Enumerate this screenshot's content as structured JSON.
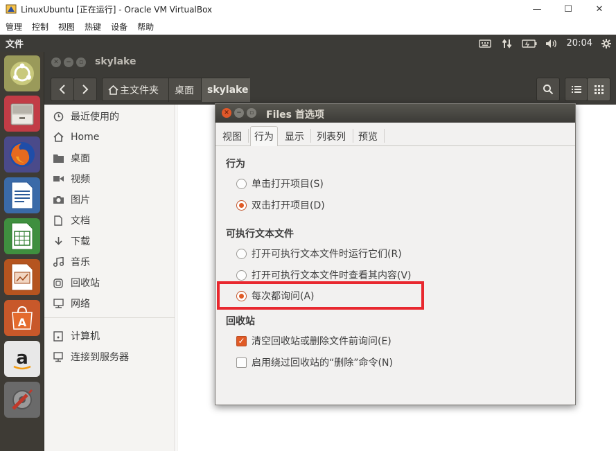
{
  "host": {
    "title": "LinuxUbuntu [正在运行] - Oracle VM VirtualBox",
    "menu": [
      "管理",
      "控制",
      "视图",
      "热键",
      "设备",
      "帮助"
    ],
    "controls": {
      "minimize": "—",
      "maximize": "☐",
      "close": "✕"
    }
  },
  "panel": {
    "app_name": "文件",
    "time": "20:04",
    "indicators": [
      "keyboard-icon",
      "network-icon",
      "battery-icon",
      "volume-icon",
      "settings-icon"
    ]
  },
  "launcher": {
    "items": [
      "ubuntu-dash-icon",
      "files-icon",
      "firefox-icon",
      "writer-icon",
      "calc-icon",
      "impress-icon",
      "software-center-icon",
      "amazon-icon",
      "system-settings-icon"
    ]
  },
  "files": {
    "title": "skylake",
    "breadcrumbs": [
      "主文件夹",
      "桌面",
      "skylake"
    ],
    "sidebar": [
      {
        "label": "最近使用的",
        "icon": "clock-icon"
      },
      {
        "label": "Home",
        "icon": "home-icon"
      },
      {
        "label": "桌面",
        "icon": "folder-icon"
      },
      {
        "label": "视频",
        "icon": "video-icon"
      },
      {
        "label": "图片",
        "icon": "camera-icon"
      },
      {
        "label": "文档",
        "icon": "document-icon"
      },
      {
        "label": "下载",
        "icon": "download-icon"
      },
      {
        "label": "音乐",
        "icon": "music-icon"
      },
      {
        "label": "回收站",
        "icon": "trash-icon"
      },
      {
        "label": "网络",
        "icon": "network-icon"
      },
      {
        "label": "计算机",
        "icon": "computer-icon"
      },
      {
        "label": "连接到服务器",
        "icon": "server-icon"
      }
    ]
  },
  "prefs": {
    "title": "Files 首选项",
    "tabs": [
      "视图",
      "行为",
      "显示",
      "列表列",
      "预览"
    ],
    "active_tab": "行为",
    "sections": {
      "behavior": {
        "header": "行为",
        "options": [
          {
            "label": "单击打开项目(S)",
            "checked": false
          },
          {
            "label": "双击打开项目(D)",
            "checked": true
          }
        ]
      },
      "executable": {
        "header": "可执行文本文件",
        "options": [
          {
            "label": "打开可执行文本文件时运行它们(R)",
            "checked": false
          },
          {
            "label": "打开可执行文本文件时查看其内容(V)",
            "checked": false
          },
          {
            "label": "每次都询问(A)",
            "checked": true
          }
        ]
      },
      "trash": {
        "header": "回收站",
        "options": [
          {
            "label": "清空回收站或删除文件前询问(E)",
            "checked": true
          },
          {
            "label": "启用绕过回收站的“删除”命令(N)",
            "checked": false
          }
        ]
      }
    }
  },
  "colors": {
    "accent": "#e05a25",
    "panel": "#3c3b37",
    "highlight": "#e8282f"
  }
}
